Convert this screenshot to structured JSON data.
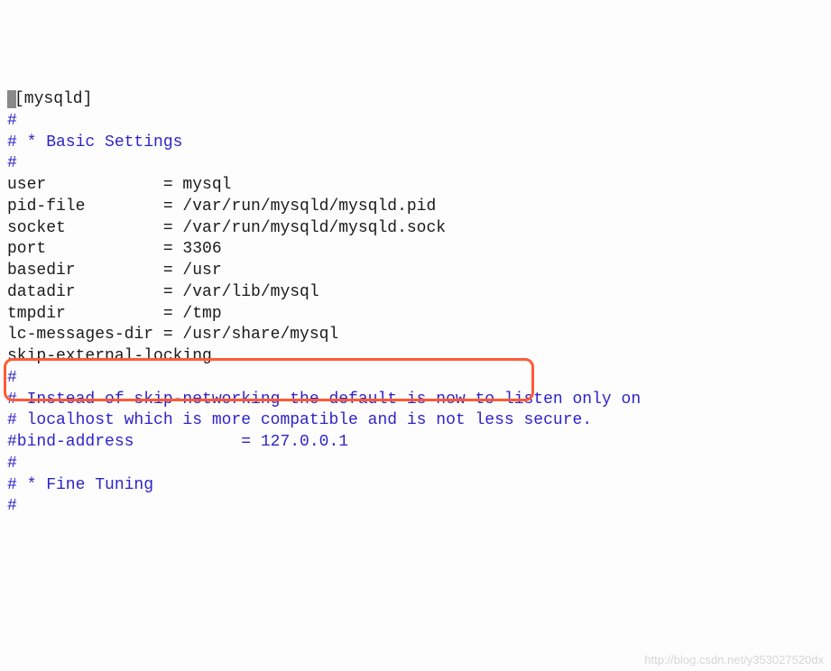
{
  "lines": {
    "section_header": "[mysqld]",
    "hash1": "#",
    "basic_settings": "# * Basic Settings",
    "hash2": "#",
    "user": "user            = mysql",
    "pidfile": "pid-file        = /var/run/mysqld/mysqld.pid",
    "socket": "socket          = /var/run/mysqld/mysqld.sock",
    "port": "port            = 3306",
    "basedir": "basedir         = /usr",
    "datadir": "datadir         = /var/lib/mysql",
    "tmpdir": "tmpdir          = /tmp",
    "lcmsg": "lc-messages-dir = /usr/share/mysql",
    "skip": "skip-external-locking",
    "hash3": "#",
    "note1": "# Instead of skip-networking the default is now to listen only on",
    "note2": "# localhost which is more compatible and is not less secure.",
    "bind": "#bind-address           = 127.0.0.1",
    "hash4": "#",
    "fine": "# * Fine Tuning",
    "hash5": "#"
  },
  "watermark": "http://blog.csdn.net/y353027520dx"
}
